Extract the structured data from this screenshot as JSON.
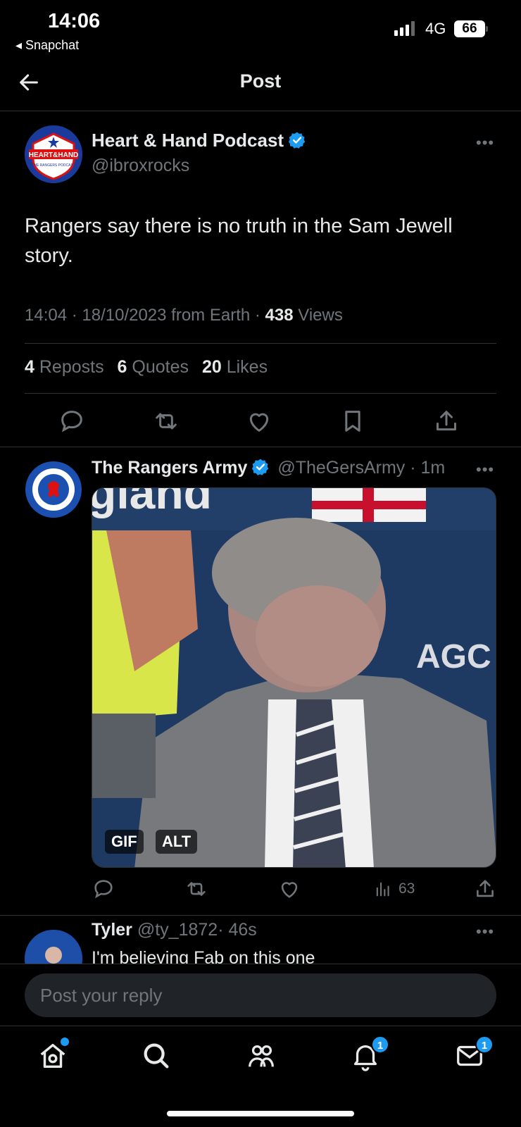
{
  "status_bar": {
    "time": "14:06",
    "back_app": "◂ Snapchat",
    "network": "4G",
    "battery": "66"
  },
  "header": {
    "title": "Post"
  },
  "main_post": {
    "author_name": "Heart & Hand Podcast",
    "author_handle": "@ibroxrocks",
    "avatar_text_main": "HEART&HAND",
    "avatar_text_sub": "THE RANGERS PODCAST",
    "text": "Rangers say there is no truth in the Sam Jewell story.",
    "time": "14:04 · 18/10/2023 from Earth · ",
    "views_count": "438",
    "views_label": "Views",
    "reposts_count": "4",
    "reposts_label": "Reposts",
    "quotes_count": "6",
    "quotes_label": "Quotes",
    "likes_count": "20",
    "likes_label": "Likes"
  },
  "reply1": {
    "author_name": "The Rangers Army",
    "author_handle": "@TheGersArmy",
    "time": "· 1m",
    "gif_label": "GIF",
    "alt_label": "ALT",
    "views": "63",
    "gif_overlay_text_top": "gland",
    "gif_overlay_text_right": "AGC"
  },
  "reply2": {
    "author_name": "Tyler",
    "author_handle": "@ty_1872",
    "time": "· 46s",
    "text": "I'm believing Fab on this one"
  },
  "reply_input": {
    "placeholder": "Post your reply"
  },
  "tabbar": {
    "notifications_badge": "1",
    "messages_badge": "1"
  },
  "colors": {
    "accent": "#1d9bf0",
    "background": "#000000",
    "muted": "#71767b",
    "divider": "#2f3336"
  }
}
